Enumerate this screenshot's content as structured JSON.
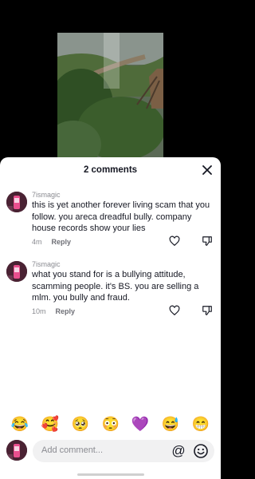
{
  "sheet": {
    "title": "2 comments"
  },
  "comments": [
    {
      "username": "7ismagic",
      "text": "this is yet another forever living scam that you follow. you areca dreadful bully. company house records show your lies",
      "time": "4m",
      "reply_label": "Reply"
    },
    {
      "username": "7ismagic",
      "text": "what you stand for is a bullying attitude, scamming people. it's BS. you are selling a mlm. you bully and fraud.",
      "time": "10m",
      "reply_label": "Reply"
    }
  ],
  "emoji_bar": [
    "😂",
    "🥰",
    "🥺",
    "😳",
    "💜",
    "😅",
    "😁"
  ],
  "composer": {
    "placeholder": "Add comment...",
    "at_symbol": "@"
  },
  "colors": {
    "sheet_bg": "#ffffff",
    "text_primary": "#161823",
    "text_secondary": "#8a8b91",
    "input_bg": "#f1f1f2"
  }
}
